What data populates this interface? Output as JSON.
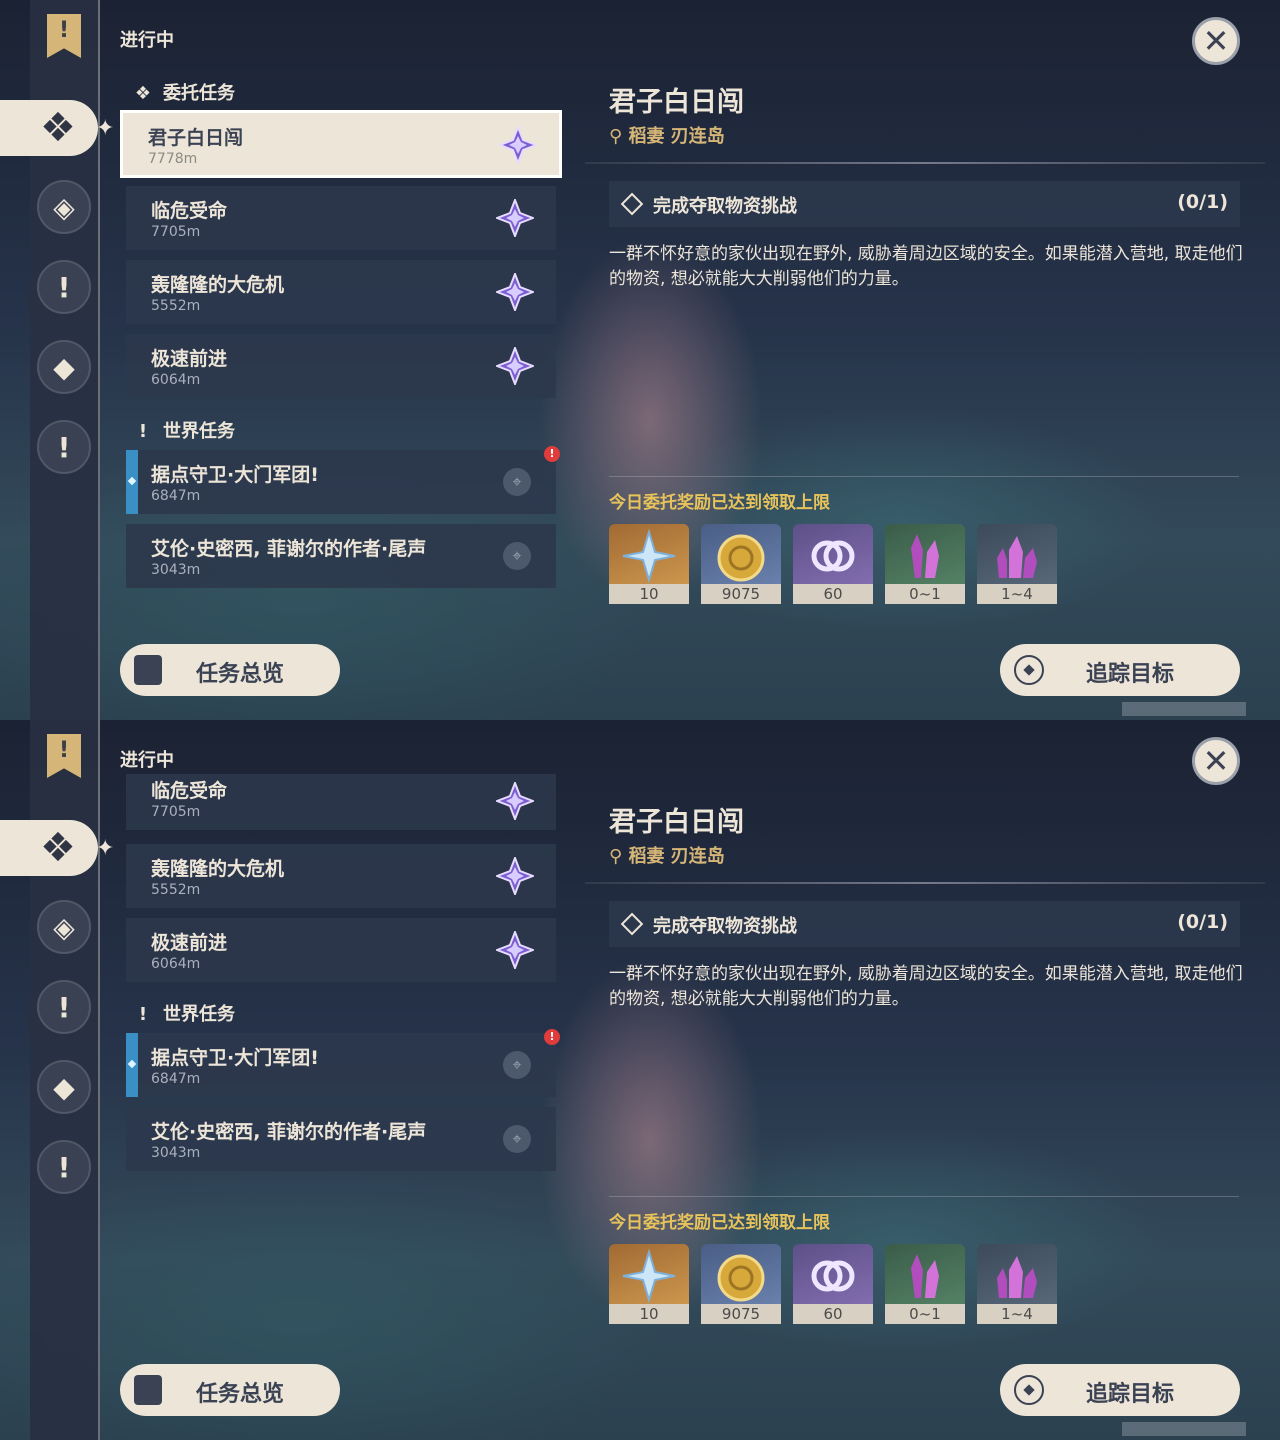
{
  "panels": [
    {
      "status_label": "进行中",
      "commission_header": "委托任务",
      "world_header": "世界任务",
      "commissions": [
        {
          "name": "君子白日闯",
          "distance": "7778m"
        },
        {
          "name": "临危受命",
          "distance": "7705m"
        },
        {
          "name": "轰隆隆的大危机",
          "distance": "5552m"
        },
        {
          "name": "极速前进",
          "distance": "6064m"
        }
      ],
      "world_quests": [
        {
          "name": "据点守卫·大门军团!",
          "distance": "6847m"
        },
        {
          "name": "艾伦·史密西, 菲谢尔的作者·尾声",
          "distance": "3043m"
        }
      ],
      "overview_button": "任务总览",
      "track_button": "追踪目标",
      "detail": {
        "title": "君子白日闯",
        "location": "稻妻 刃连岛",
        "objective": "完成夺取物资挑战",
        "objective_count": "(0/1)",
        "description": "一群不怀好意的家伙出现在野外, 威胁着周边区域的安全。如果能潜入营地, 取走他们的物资, 想必就能大大削弱他们的力量。",
        "reward_limit": "今日委托奖励已达到领取上限",
        "rewards": [
          {
            "item": "primogem-icon",
            "qty": "10",
            "rarity_color": "#c58a42"
          },
          {
            "item": "mora-coin-icon",
            "qty": "9075",
            "rarity_color": "#5e73a0"
          },
          {
            "item": "companionship-exp-icon",
            "qty": "60",
            "rarity_color": "#7563a4"
          },
          {
            "item": "crystal-icon",
            "qty": "0~1",
            "rarity_color": "#4a7058"
          },
          {
            "item": "crystal-cluster-icon",
            "qty": "1~4",
            "rarity_color": "#4d5c6e"
          }
        ]
      }
    },
    {
      "status_label": "进行中",
      "world_header": "世界任务",
      "commissions": [
        {
          "name": "临危受命",
          "distance": "7705m"
        },
        {
          "name": "轰隆隆的大危机",
          "distance": "5552m"
        },
        {
          "name": "极速前进",
          "distance": "6064m"
        }
      ],
      "world_quests": [
        {
          "name": "据点守卫·大门军团!",
          "distance": "6847m"
        },
        {
          "name": "艾伦·史密西, 菲谢尔的作者·尾声",
          "distance": "3043m"
        }
      ],
      "overview_button": "任务总览",
      "track_button": "追踪目标",
      "detail": {
        "title": "君子白日闯",
        "location": "稻妻 刃连岛",
        "objective": "完成夺取物资挑战",
        "objective_count": "(0/1)",
        "description": "一群不怀好意的家伙出现在野外, 威胁着周边区域的安全。如果能潜入营地, 取走他们的物资, 想必就能大大削弱他们的力量。",
        "reward_limit": "今日委托奖励已达到领取上限",
        "rewards": [
          {
            "item": "primogem-icon",
            "qty": "10"
          },
          {
            "item": "mora-coin-icon",
            "qty": "9075"
          },
          {
            "item": "companionship-exp-icon",
            "qty": "60"
          },
          {
            "item": "crystal-icon",
            "qty": "0~1"
          },
          {
            "item": "crystal-cluster-icon",
            "qty": "1~4"
          }
        ]
      }
    }
  ],
  "colors": {
    "parchment": "#ece5d8",
    "gold": "#d6b678",
    "limit_yellow": "#e8c35a",
    "alert_red": "#e03c3c",
    "world_bar": "#3a8fc4"
  }
}
